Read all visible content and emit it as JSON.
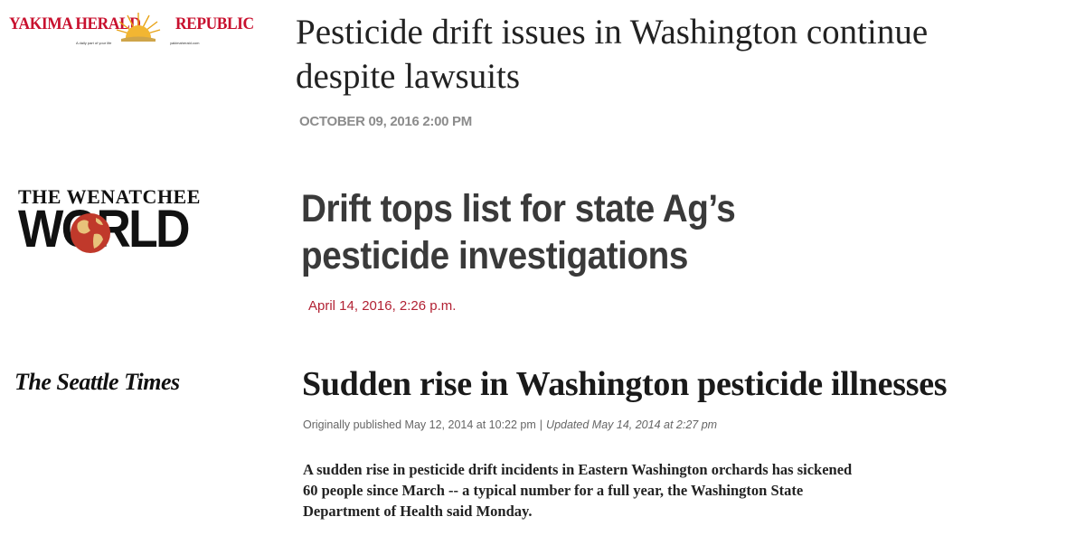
{
  "articles": [
    {
      "publication": {
        "name_left": "YAKIMA HERALD",
        "name_right": "REPUBLIC",
        "tagline": "A daily part of your life",
        "url": "yakimaherald.com",
        "brand_color": "#c8102e",
        "sun_color": "#e8a317"
      },
      "headline": "Pesticide drift issues in Washington continue despite lawsuits",
      "date": "OCTOBER 09, 2016 2:00 PM"
    },
    {
      "publication": {
        "name_top": "THE WENATCHEE",
        "name_bottom": "WORLD",
        "globe_color": "#c0392b"
      },
      "headline": "Drift tops list for state Ag’s pesticide investigations",
      "date": "April 14, 2016, 2:26 p.m.",
      "date_color": "#b22234"
    },
    {
      "publication": {
        "name": "The Seattle Times"
      },
      "headline": "Sudden rise in Washington pesticide illnesses",
      "originally_published": "Originally published May 12, 2014 at 10:22 pm",
      "separator": "|",
      "updated": "Updated May 14, 2014 at 2:27 pm",
      "summary": "A sudden rise in pesticide drift incidents in Eastern Washington orchards has sickened 60 people since March -- a typical number for a full year, the Washington State Department of Health said Monday."
    }
  ]
}
